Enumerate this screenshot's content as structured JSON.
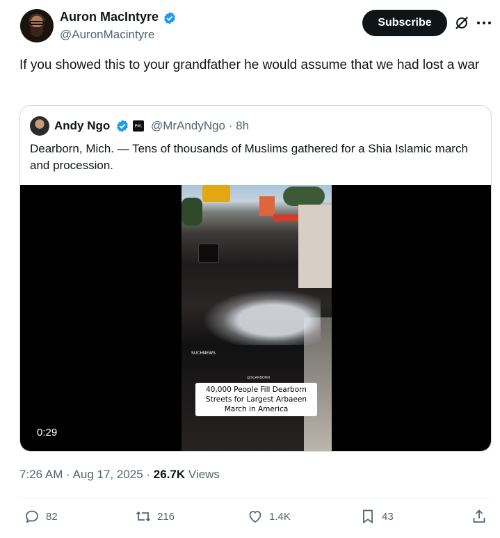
{
  "author": {
    "name": "Auron MacIntyre",
    "handle": "@AuronMacintyre",
    "verified": true
  },
  "subscribe_label": "Subscribe",
  "tweet_text": "If you showed this to your grandfather he would assume that we had lost a war",
  "quote": {
    "name": "Andy Ngo",
    "badge_text": "PM.",
    "handle_time": "@MrAndyNgo · 8h",
    "text": "Dearborn, Mich. — Tens of thousands of Muslims gathered for a Shia Islamic march and procession.",
    "video": {
      "caption": "40,000 People Fill Dearborn Streets for Largest Arbaeen March in America",
      "watermark": "SUCHNEWS",
      "watermark2": "@SCARBORN",
      "duration": "0:29"
    }
  },
  "meta": {
    "time_date": "7:26 AM · Aug 17, 2025 · ",
    "views_count": "26.7K",
    "views_label": " Views"
  },
  "actions": {
    "replies": "82",
    "reposts": "216",
    "likes": "1.4K",
    "bookmarks": "43"
  },
  "colors": {
    "verified": "#1d9bf0",
    "text_secondary": "#536471",
    "primary_text": "#0f1419",
    "border": "#cfd9de"
  },
  "icons": [
    "verified-badge-icon",
    "grok-icon",
    "more-icon",
    "reply-icon",
    "repost-icon",
    "like-icon",
    "bookmark-icon",
    "share-icon"
  ]
}
